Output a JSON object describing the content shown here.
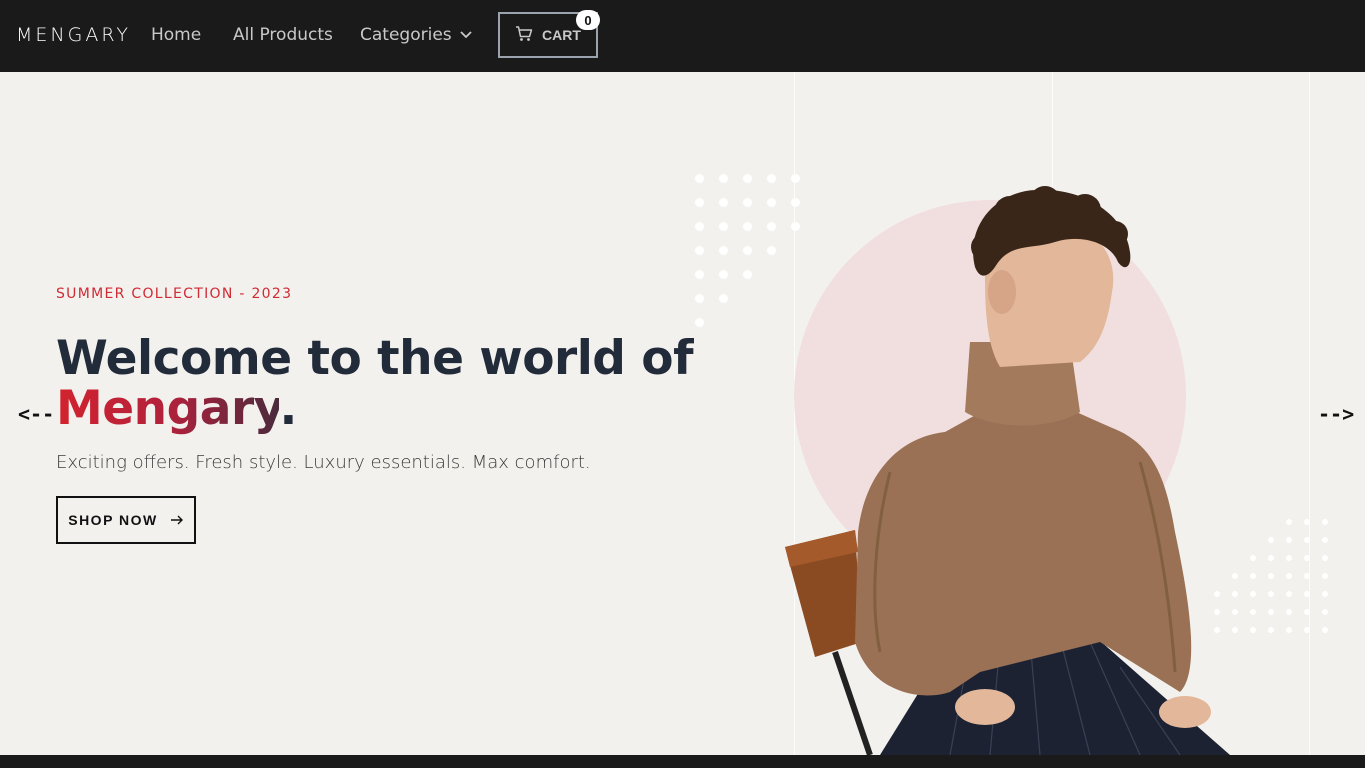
{
  "nav": {
    "logo": "MENGARY",
    "links": [
      "Home",
      "All Products",
      "Categories"
    ],
    "cart_label": "CART",
    "cart_count": "0"
  },
  "hero": {
    "eyebrow": "SUMMER COLLECTION - 2023",
    "headline_line1": "Welcome to the world of",
    "brand_word": "Mengary",
    "period": ".",
    "subtitle": "Exciting offers. Fresh style. Luxury essentials. Max comfort.",
    "cta": "SHOP NOW",
    "prev_arrow": "<--",
    "next_arrow": "-->"
  },
  "icons": [
    "cart-icon",
    "chevron-down-icon",
    "arrow-right-icon"
  ],
  "colors": {
    "nav_bg": "#1a1a1b",
    "hero_bg": "#f3f1ee",
    "accent_red": "#d02a34",
    "headline": "#222b3a",
    "circle": "#f1dfe0"
  }
}
